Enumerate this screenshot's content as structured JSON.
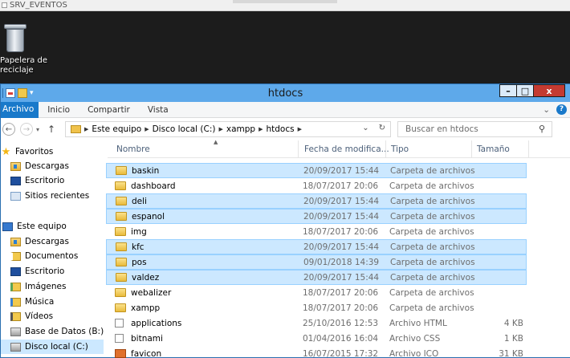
{
  "rdp": {
    "title": "SRV_EVENTOS"
  },
  "desktop": {
    "recycle_label_1": "Papelera de",
    "recycle_label_2": "reciclaje"
  },
  "window": {
    "title": "htdocs",
    "controls": {
      "minimize": "–",
      "maximize": "□",
      "close": "x"
    }
  },
  "ribbon": {
    "file_tab": "Archivo",
    "tabs": [
      "Inicio",
      "Compartir",
      "Vista"
    ],
    "expand": "⌄",
    "help": "?"
  },
  "address": {
    "crumbs": [
      "Este equipo",
      "Disco local (C:)",
      "xampp",
      "htdocs"
    ],
    "dropdown": "⌄",
    "refresh": "↻"
  },
  "search": {
    "placeholder": "Buscar en htdocs",
    "icon": "search-icon"
  },
  "nav": {
    "items": [
      {
        "label": "Favoritos",
        "icon": "star-icon"
      },
      {
        "label": "Descargas",
        "icon": "downloads-folder-icon"
      },
      {
        "label": "Escritorio",
        "icon": "desktop-icon"
      },
      {
        "label": "Sitios recientes",
        "icon": "recent-places-icon"
      },
      {
        "label": "Este equipo",
        "icon": "computer-icon"
      },
      {
        "label": "Descargas",
        "icon": "downloads-folder-icon"
      },
      {
        "label": "Documentos",
        "icon": "documents-folder-icon"
      },
      {
        "label": "Escritorio",
        "icon": "desktop-folder-icon"
      },
      {
        "label": "Imágenes",
        "icon": "pictures-folder-icon"
      },
      {
        "label": "Música",
        "icon": "music-folder-icon"
      },
      {
        "label": "Vídeos",
        "icon": "videos-folder-icon"
      },
      {
        "label": "Base de Datos (B:)",
        "icon": "network-drive-icon"
      },
      {
        "label": "Disco local (C:)",
        "icon": "local-disk-icon"
      }
    ]
  },
  "columns": {
    "name": "Nombre",
    "date": "Fecha de modifica...",
    "type": "Tipo",
    "size": "Tamaño"
  },
  "files": [
    {
      "name": "baskin",
      "date": "20/09/2017 15:44",
      "type": "Carpeta de archivos",
      "size": "",
      "icon": "folder-icon",
      "selected": true
    },
    {
      "name": "dashboard",
      "date": "18/07/2017 20:06",
      "type": "Carpeta de archivos",
      "size": "",
      "icon": "folder-icon",
      "selected": false
    },
    {
      "name": "deli",
      "date": "20/09/2017 15:44",
      "type": "Carpeta de archivos",
      "size": "",
      "icon": "folder-icon",
      "selected": true
    },
    {
      "name": "espanol",
      "date": "20/09/2017 15:44",
      "type": "Carpeta de archivos",
      "size": "",
      "icon": "folder-icon",
      "selected": true
    },
    {
      "name": "img",
      "date": "18/07/2017 20:06",
      "type": "Carpeta de archivos",
      "size": "",
      "icon": "folder-icon",
      "selected": false
    },
    {
      "name": "kfc",
      "date": "20/09/2017 15:44",
      "type": "Carpeta de archivos",
      "size": "",
      "icon": "folder-icon",
      "selected": true
    },
    {
      "name": "pos",
      "date": "09/01/2018 14:39",
      "type": "Carpeta de archivos",
      "size": "",
      "icon": "folder-icon",
      "selected": true
    },
    {
      "name": "valdez",
      "date": "20/09/2017 15:44",
      "type": "Carpeta de archivos",
      "size": "",
      "icon": "folder-icon",
      "selected": true
    },
    {
      "name": "webalizer",
      "date": "18/07/2017 20:06",
      "type": "Carpeta de archivos",
      "size": "",
      "icon": "folder-icon",
      "selected": false
    },
    {
      "name": "xampp",
      "date": "18/07/2017 20:06",
      "type": "Carpeta de archivos",
      "size": "",
      "icon": "folder-icon",
      "selected": false
    },
    {
      "name": "applications",
      "date": "25/10/2016 12:53",
      "type": "Archivo HTML",
      "size": "4 KB",
      "icon": "html-file-icon",
      "selected": false
    },
    {
      "name": "bitnami",
      "date": "01/04/2016 16:04",
      "type": "Archivo CSS",
      "size": "1 KB",
      "icon": "css-file-icon",
      "selected": false
    },
    {
      "name": "favicon",
      "date": "16/07/2015 17:32",
      "type": "Archivo ICO",
      "size": "31 KB",
      "icon": "ico-file-icon",
      "selected": false
    }
  ]
}
